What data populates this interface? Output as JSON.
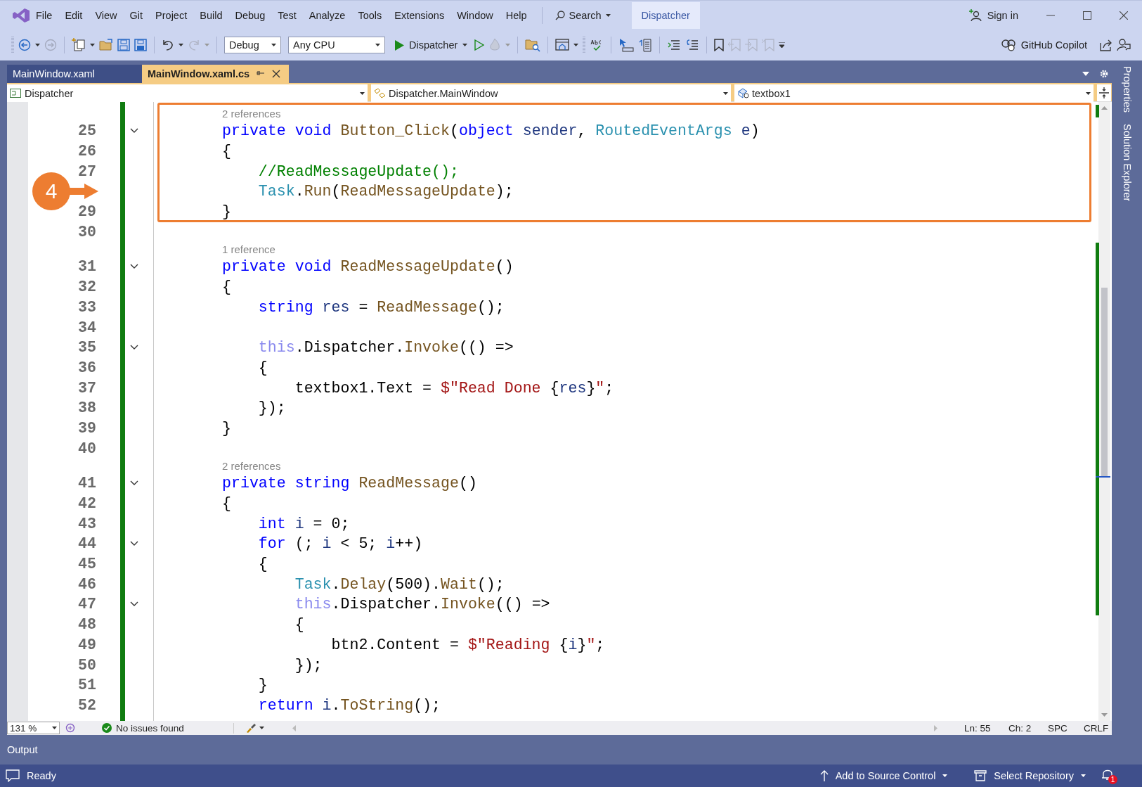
{
  "menu": [
    {
      "label": "File"
    },
    {
      "label": "Edit"
    },
    {
      "label": "View"
    },
    {
      "label": "Git"
    },
    {
      "label": "Project"
    },
    {
      "label": "Build"
    },
    {
      "label": "Debug"
    },
    {
      "label": "Test"
    },
    {
      "label": "Analyze"
    },
    {
      "label": "Tools"
    },
    {
      "label": "Extensions"
    },
    {
      "label": "Window"
    },
    {
      "label": "Help"
    }
  ],
  "search": {
    "label": "Search"
  },
  "solution_name": "Dispatcher",
  "account": {
    "label": "Sign in"
  },
  "toolbar": {
    "configuration": "Debug",
    "platform": "Any CPU",
    "start": "Dispatcher",
    "copilot": "GitHub Copilot"
  },
  "document_tabs": [
    {
      "label": "MainWindow.xaml",
      "selected": false
    },
    {
      "label": "MainWindow.xaml.cs",
      "selected": true
    }
  ],
  "navigation": {
    "project": "Dispatcher",
    "type": "Dispatcher.MainWindow",
    "member": "textbox1"
  },
  "code_lines": [
    {
      "kind": "lens",
      "text": "2 references"
    },
    {
      "kind": "code",
      "number": "25",
      "fold": true,
      "tokens": [
        {
          "text": "private",
          "kind": "keyword"
        },
        {
          "text": " void",
          "kind": "keyword"
        },
        {
          "text": " Button_Click",
          "kind": "method"
        },
        {
          "text": "(",
          "kind": "plain"
        },
        {
          "text": "object",
          "kind": "keyword"
        },
        {
          "text": " sender",
          "kind": "variable"
        },
        {
          "text": ",",
          "kind": "plain"
        },
        {
          "text": " RoutedEventArgs",
          "kind": "type"
        },
        {
          "text": " e",
          "kind": "variable"
        },
        {
          "text": ")",
          "kind": "plain"
        }
      ]
    },
    {
      "kind": "code",
      "number": "26",
      "fold": false,
      "tokens": [
        {
          "text": "{",
          "kind": "plain"
        }
      ]
    },
    {
      "kind": "code",
      "number": "27",
      "fold": false,
      "tokens": [
        {
          "text": "    //ReadMessageUpdate();",
          "kind": "comment"
        }
      ]
    },
    {
      "kind": "code",
      "fold": false,
      "tokens": [
        {
          "text": "    Task",
          "kind": "type"
        },
        {
          "text": ".",
          "kind": "plain"
        },
        {
          "text": "Run",
          "kind": "method"
        },
        {
          "text": "(",
          "kind": "plain"
        },
        {
          "text": "ReadMessageUpdate",
          "kind": "method"
        },
        {
          "text": ");",
          "kind": "plain"
        }
      ]
    },
    {
      "kind": "code",
      "number": "29",
      "fold": false,
      "tokens": [
        {
          "text": "}",
          "kind": "plain"
        }
      ]
    },
    {
      "kind": "code",
      "number": "30",
      "fold": false
    },
    {
      "kind": "lens",
      "text": "1 reference"
    },
    {
      "kind": "code",
      "number": "31",
      "fold": true,
      "tokens": [
        {
          "text": "private",
          "kind": "keyword"
        },
        {
          "text": " void",
          "kind": "keyword"
        },
        {
          "text": " ReadMessageUpdate",
          "kind": "method"
        },
        {
          "text": "()",
          "kind": "plain"
        }
      ]
    },
    {
      "kind": "code",
      "number": "32",
      "fold": false,
      "tokens": [
        {
          "text": "{",
          "kind": "plain"
        }
      ]
    },
    {
      "kind": "code",
      "number": "33",
      "fold": false,
      "tokens": [
        {
          "text": "    string",
          "kind": "keyword"
        },
        {
          "text": " res",
          "kind": "variable"
        },
        {
          "text": " = ",
          "kind": "plain"
        },
        {
          "text": "ReadMessage",
          "kind": "method"
        },
        {
          "text": "();",
          "kind": "plain"
        }
      ]
    },
    {
      "kind": "code",
      "number": "34",
      "fold": false
    },
    {
      "kind": "code",
      "number": "35",
      "fold": true,
      "tokens": [
        {
          "text": "    this",
          "kind": "this"
        },
        {
          "text": ".Dispatcher.",
          "kind": "plain"
        },
        {
          "text": "Invoke",
          "kind": "method"
        },
        {
          "text": "(() =>",
          "kind": "plain"
        }
      ]
    },
    {
      "kind": "code",
      "number": "36",
      "fold": false,
      "tokens": [
        {
          "text": "    {",
          "kind": "plain"
        }
      ]
    },
    {
      "kind": "code",
      "number": "37",
      "fold": false,
      "tokens": [
        {
          "text": "        textbox1.Text = ",
          "kind": "plain"
        },
        {
          "text": "$\"Read Done ",
          "kind": "string"
        },
        {
          "text": "{",
          "kind": "plain"
        },
        {
          "text": "res",
          "kind": "variable"
        },
        {
          "text": "}",
          "kind": "plain"
        },
        {
          "text": "\"",
          "kind": "string"
        },
        {
          "text": ";",
          "kind": "plain"
        }
      ]
    },
    {
      "kind": "code",
      "number": "38",
      "fold": false,
      "tokens": [
        {
          "text": "    });",
          "kind": "plain"
        }
      ]
    },
    {
      "kind": "code",
      "number": "39",
      "fold": false,
      "tokens": [
        {
          "text": "}",
          "kind": "plain"
        }
      ]
    },
    {
      "kind": "code",
      "number": "40",
      "fold": false
    },
    {
      "kind": "lens",
      "text": "2 references"
    },
    {
      "kind": "code",
      "number": "41",
      "fold": true,
      "tokens": [
        {
          "text": "private",
          "kind": "keyword"
        },
        {
          "text": " string",
          "kind": "keyword"
        },
        {
          "text": " ReadMessage",
          "kind": "method"
        },
        {
          "text": "()",
          "kind": "plain"
        }
      ]
    },
    {
      "kind": "code",
      "number": "42",
      "fold": false,
      "tokens": [
        {
          "text": "{",
          "kind": "plain"
        }
      ]
    },
    {
      "kind": "code",
      "number": "43",
      "fold": false,
      "tokens": [
        {
          "text": "    int",
          "kind": "keyword"
        },
        {
          "text": " i",
          "kind": "variable"
        },
        {
          "text": " = 0;",
          "kind": "plain"
        }
      ]
    },
    {
      "kind": "code",
      "number": "44",
      "fold": true,
      "tokens": [
        {
          "text": "    for",
          "kind": "keyword"
        },
        {
          "text": " (; ",
          "kind": "plain"
        },
        {
          "text": "i",
          "kind": "variable"
        },
        {
          "text": " < 5; ",
          "kind": "plain"
        },
        {
          "text": "i",
          "kind": "variable"
        },
        {
          "text": "++)",
          "kind": "plain"
        }
      ]
    },
    {
      "kind": "code",
      "number": "45",
      "fold": false,
      "tokens": [
        {
          "text": "    {",
          "kind": "plain"
        }
      ]
    },
    {
      "kind": "code",
      "number": "46",
      "fold": false,
      "tokens": [
        {
          "text": "        Task",
          "kind": "type"
        },
        {
          "text": ".",
          "kind": "plain"
        },
        {
          "text": "Delay",
          "kind": "method"
        },
        {
          "text": "(500).",
          "kind": "plain"
        },
        {
          "text": "Wait",
          "kind": "method"
        },
        {
          "text": "();",
          "kind": "plain"
        }
      ]
    },
    {
      "kind": "code",
      "number": "47",
      "fold": true,
      "tokens": [
        {
          "text": "        this",
          "kind": "this"
        },
        {
          "text": ".Dispatcher.",
          "kind": "plain"
        },
        {
          "text": "Invoke",
          "kind": "method"
        },
        {
          "text": "(() =>",
          "kind": "plain"
        }
      ]
    },
    {
      "kind": "code",
      "number": "48",
      "fold": false,
      "tokens": [
        {
          "text": "        {",
          "kind": "plain"
        }
      ]
    },
    {
      "kind": "code",
      "number": "49",
      "fold": false,
      "tokens": [
        {
          "text": "            btn2.Content = ",
          "kind": "plain"
        },
        {
          "text": "$\"Reading ",
          "kind": "string"
        },
        {
          "text": "{",
          "kind": "plain"
        },
        {
          "text": "i",
          "kind": "variable"
        },
        {
          "text": "}",
          "kind": "plain"
        },
        {
          "text": "\"",
          "kind": "string"
        },
        {
          "text": ";",
          "kind": "plain"
        }
      ]
    },
    {
      "kind": "code",
      "number": "50",
      "fold": false,
      "tokens": [
        {
          "text": "        });",
          "kind": "plain"
        }
      ]
    },
    {
      "kind": "code",
      "number": "51",
      "fold": false,
      "tokens": [
        {
          "text": "    }",
          "kind": "plain"
        }
      ]
    },
    {
      "kind": "code",
      "number": "52",
      "fold": false,
      "tokens": [
        {
          "text": "    return",
          "kind": "keyword"
        },
        {
          "text": " i",
          "kind": "variable"
        },
        {
          "text": ".",
          "kind": "plain"
        },
        {
          "text": "ToString",
          "kind": "method"
        },
        {
          "text": "();",
          "kind": "plain"
        }
      ]
    }
  ],
  "callout": {
    "number": "4"
  },
  "editor_status": {
    "zoom": "131 %",
    "issues": "No issues found",
    "line": "Ln: 55",
    "column": "Ch: 2",
    "whitespace": "SPC",
    "line_ending": "CRLF"
  },
  "output_panel": {
    "title": "Output"
  },
  "status_bar": {
    "state": "Ready",
    "source_control": "Add to Source Control",
    "repository": "Select Repository",
    "notifications": "1"
  },
  "side_tabs": [
    {
      "label": "Properties"
    },
    {
      "label": "Solution Explorer"
    }
  ]
}
